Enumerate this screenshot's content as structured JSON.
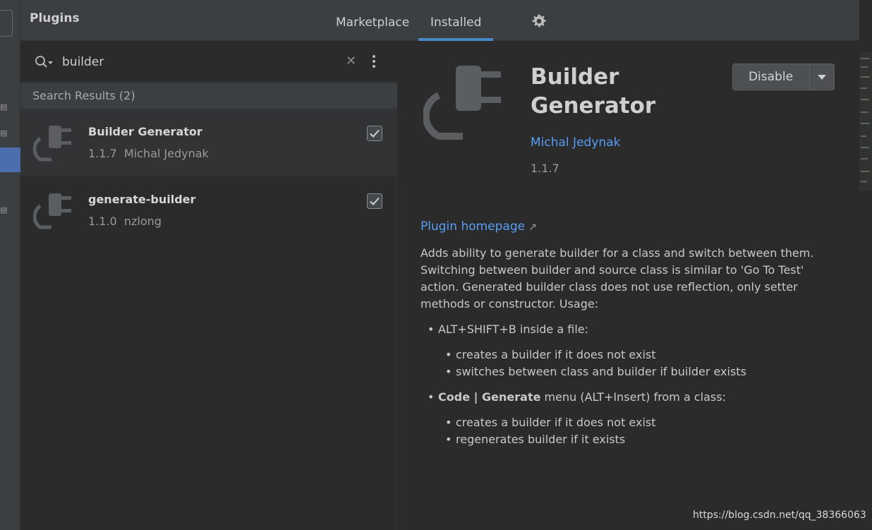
{
  "header": {
    "title": "Plugins",
    "tabs": [
      {
        "label": "Marketplace",
        "active": false
      },
      {
        "label": "Installed",
        "active": true
      }
    ],
    "settings_icon": "gear-icon"
  },
  "search": {
    "value": "builder",
    "placeholder": ""
  },
  "results": {
    "header": "Search Results (2)",
    "items": [
      {
        "name": "Builder Generator",
        "meta": "1.1.7  Michal Jedynak",
        "checked": true,
        "selected": true
      },
      {
        "name": "generate-builder",
        "meta": "1.1.0  nzlong",
        "checked": true,
        "selected": false
      }
    ]
  },
  "detail": {
    "title": "Builder Generator",
    "author": "Michal Jedynak",
    "version": "1.1.7",
    "action_button": "Disable",
    "homepage_link": "Plugin homepage",
    "homepage_arrow": "↗",
    "description": "Adds ability to generate builder for a class and switch between them. Switching between builder and source class is similar to 'Go To Test' action. Generated builder class does not use reflection, only setter methods or constructor. Usage:",
    "usage": [
      {
        "prefix_bold": "",
        "text": "ALT+SHIFT+B inside a file:",
        "sub": [
          "creates a builder if it does not exist",
          "switches between class and builder if builder exists"
        ]
      },
      {
        "prefix_bold": "Code | Generate",
        "text": " menu (ALT+Insert) from a class:",
        "sub": [
          "creates a builder if it does not exist",
          "regenerates builder if it exists"
        ]
      }
    ]
  },
  "watermark": "https://blog.csdn.net/qq_38366063",
  "colors": {
    "accent": "#4a88c7",
    "link": "#589df6",
    "background": "#2b2b2b",
    "panel": "#3c3f41"
  }
}
